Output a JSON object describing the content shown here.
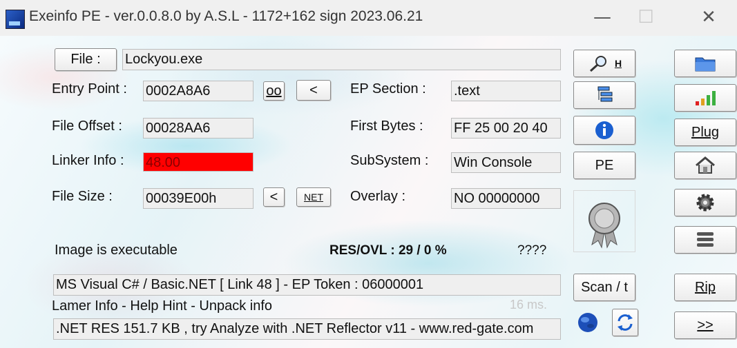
{
  "window": {
    "title": "Exeinfo PE - ver.0.0.8.0  by A.S.L -  1172+162 sign  2023.06.21",
    "min_glyph": "—",
    "max_glyph": "☐",
    "close_glyph": "✕"
  },
  "file": {
    "button_label": "File :",
    "value": "Lockyou.exe"
  },
  "entry_point": {
    "label": "Entry Point :",
    "value": "0002A8A6",
    "oo_label": "oo",
    "lt_label": "<"
  },
  "file_offset": {
    "label": "File Offset :",
    "value": "00028AA6"
  },
  "linker_info": {
    "label": "Linker Info :",
    "value": "48.00",
    "highlight_color": "#ff0000"
  },
  "file_size": {
    "label": "File Size :",
    "value": "00039E00h",
    "lt_label": "<",
    "net_label": "NET"
  },
  "ep_section": {
    "label": "EP Section :",
    "value": ".text"
  },
  "first_bytes": {
    "label": "First Bytes :",
    "value": "FF 25 00 20 40"
  },
  "subsystem": {
    "label": "SubSystem :",
    "value": "Win Console"
  },
  "overlay": {
    "label": "Overlay :",
    "value": "NO   00000000"
  },
  "status": {
    "image_text": "Image is executable",
    "res_ovl": "RES/OVL : 29 / 0 %",
    "unknown": "????"
  },
  "detection": "MS Visual C# / Basic.NET  [ Link 48 ]  - EP Token : 06000001",
  "lamer_info": "Lamer Info - Help Hint - Unpack info",
  "timing": "16 ms.",
  "hint": ".NET RES 151.7 KB , try Analyze with .NET Reflector v11 - www.red-gate.com",
  "side_buttons": {
    "h_label": "H",
    "pe_label": "PE",
    "scan_label": "Scan / t",
    "plug_label": "Plug",
    "rip_label": "Rip",
    "next_label": ">>"
  },
  "colors": {
    "accent_blue": "#1a5fd0",
    "highlight_red": "#ff0000"
  }
}
